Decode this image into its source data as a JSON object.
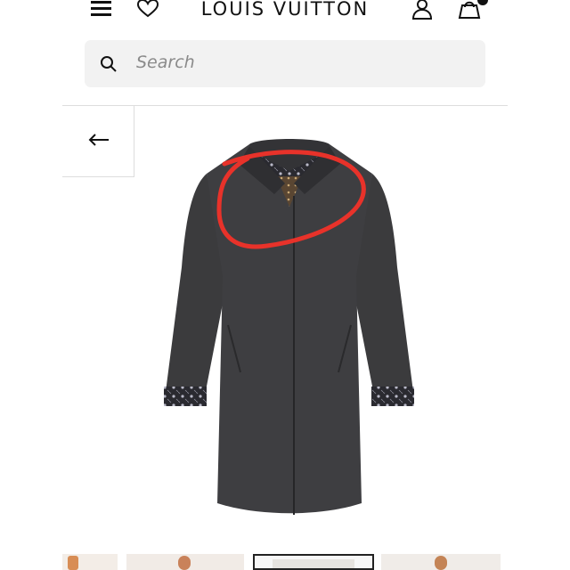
{
  "header": {
    "brand": "LOUIS VUITTON",
    "icons": [
      "menu-icon",
      "heart-icon",
      "account-icon",
      "shopping-bag-icon"
    ]
  },
  "search": {
    "placeholder": "Search"
  },
  "product": {
    "image": "dark-grey-wool-coat",
    "annotation_color": "#e8322a"
  },
  "thumbnails": {
    "count": 4,
    "active_index": 2
  }
}
